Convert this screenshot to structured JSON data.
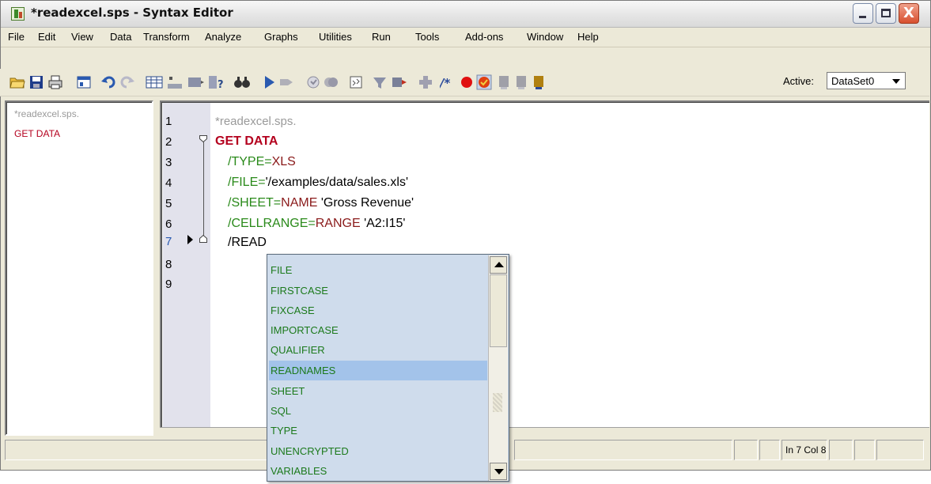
{
  "window": {
    "title": "*readexcel.sps - Syntax Editor",
    "controls": {
      "minimize": "_",
      "maximize": "□",
      "close": "X"
    }
  },
  "menu": [
    "File",
    "Edit",
    "View",
    "Data",
    "Transform",
    "Analyze",
    "Graphs",
    "Utilities",
    "Run",
    "Tools",
    "Add-ons",
    "Window",
    "Help"
  ],
  "toolbar": {
    "icons": [
      "open-folder-icon",
      "save-disk-icon",
      "print-icon",
      "dialog-recall-icon",
      "undo-icon",
      "redo-icon",
      "goto-data-icon",
      "goto-case-icon",
      "goto-variable-icon",
      "variables-icon",
      "find-icon",
      "run-selection-icon",
      "stop-processor-icon",
      "validate-icon",
      "run-all-icon",
      "syntax-help-icon",
      "select-cases-icon",
      "show-value-labels-icon",
      "use-variable-sets-icon",
      "comment-icon",
      "breakpoint-icon",
      "step-icon",
      "bookmark-icon",
      "next-bookmark-icon",
      "previous-bookmark-icon"
    ],
    "active_label": "Active:",
    "active_dataset": "DataSet0"
  },
  "nav": {
    "items": [
      {
        "label": "*readexcel.sps.",
        "color": "#9a9a9a"
      },
      {
        "label": "GET DATA",
        "color": "#b4001e"
      }
    ]
  },
  "editor": {
    "line_numbers": [
      "1",
      "2",
      "3",
      "4",
      "5",
      "6",
      "7",
      "8",
      "9"
    ],
    "lines": {
      "l1": "*readexcel.sps.",
      "l2": "GET DATA",
      "l3": {
        "sub": "/TYPE=",
        "kw": "XLS"
      },
      "l4": {
        "sub": "/FILE=",
        "val": "'/examples/data/sales.xls'"
      },
      "l5": {
        "sub": "/SHEET=",
        "kw": "NAME",
        "val": " 'Gross Revenue'"
      },
      "l6": {
        "sub": "/CELLRANGE=",
        "kw": "RANGE",
        "val": " 'A2:I15'"
      },
      "l7": "/READ"
    }
  },
  "autocomplete": {
    "items": [
      "FILE",
      "FIRSTCASE",
      "FIXCASE",
      "IMPORTCASE",
      "QUALIFIER",
      "READNAMES",
      "SHEET",
      "SQL",
      "TYPE",
      "UNENCRYPTED",
      "VARIABLES"
    ],
    "selected": "READNAMES"
  },
  "status": {
    "position": "In 7 Col 8"
  },
  "colors": {
    "command": "#b4001e",
    "subcommand": "#2a8a1a",
    "keyword": "#8a1a1a",
    "comment": "#9a9a9a",
    "popup_bg": "#cfdcec",
    "popup_selected": "#a3c3ea"
  }
}
